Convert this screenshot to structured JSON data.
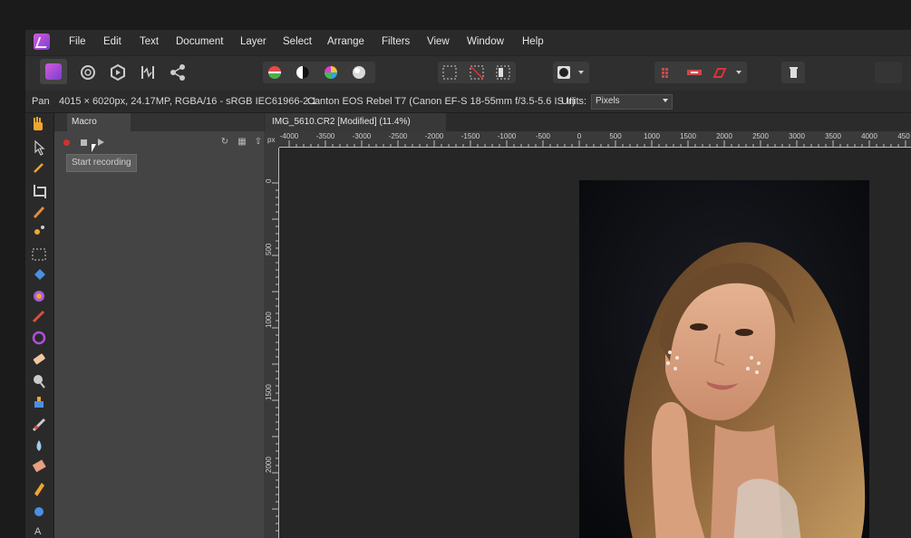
{
  "menu": [
    "File",
    "Edit",
    "Text",
    "Document",
    "Layer",
    "Select",
    "Arrange",
    "Filters",
    "View",
    "Window",
    "Help"
  ],
  "context": {
    "tool": "Pan",
    "info": "4015 × 6020px, 24.17MP, RGBA/16 - sRGB IEC61966-2.1",
    "camera": "Canton EOS Rebel T7 (Canon EF-S 18-55mm f/3.5-5.6 IS II)",
    "units_label": "Units:",
    "units_value": "Pixels"
  },
  "panel": {
    "tab": "Macro",
    "tooltip": "Start recording"
  },
  "document": {
    "tab": "IMG_5610.CR2 [Modified] (11.4%)",
    "ruler_unit": "px",
    "hruler": [
      "-4000",
      "-3500",
      "-3000",
      "-2500",
      "-2000",
      "-1500",
      "-1000",
      "-500",
      "0",
      "500",
      "1000",
      "1500",
      "2000",
      "2500",
      "3000",
      "3500",
      "4000",
      "450"
    ],
    "vruler": [
      "0",
      "500",
      "1000",
      "1500",
      "2000",
      "2500",
      "3000",
      "3500",
      "4000",
      "4500"
    ]
  },
  "icons": {
    "toolbar": [
      "affinity-photo-persona-icon",
      "liquify-persona-icon",
      "develop-persona-icon",
      "tone-mapping-persona-icon",
      "export-persona-icon",
      "auto-levels-icon",
      "auto-contrast-icon",
      "auto-colors-icon",
      "auto-white-balance-icon",
      "marquee-selection-icon",
      "deselect-icon",
      "invert-pixel-selection-icon",
      "quick-mask-icon",
      "snapping-icon",
      "assistant-icon",
      "trash-icon"
    ],
    "tools": [
      "hand-icon",
      "move-icon",
      "color-picker-icon",
      "crop-icon",
      "brush-icon",
      "selection-brush-icon",
      "marquee-icon",
      "flood-fill-icon",
      "gradient-icon",
      "paint-brush-icon",
      "color-replacement-icon",
      "eraser-icon",
      "dodge-icon",
      "clone-icon",
      "healing-icon",
      "blur-icon",
      "sponge-icon",
      "pen-icon",
      "vector-shape-icon",
      "text-icon"
    ]
  }
}
